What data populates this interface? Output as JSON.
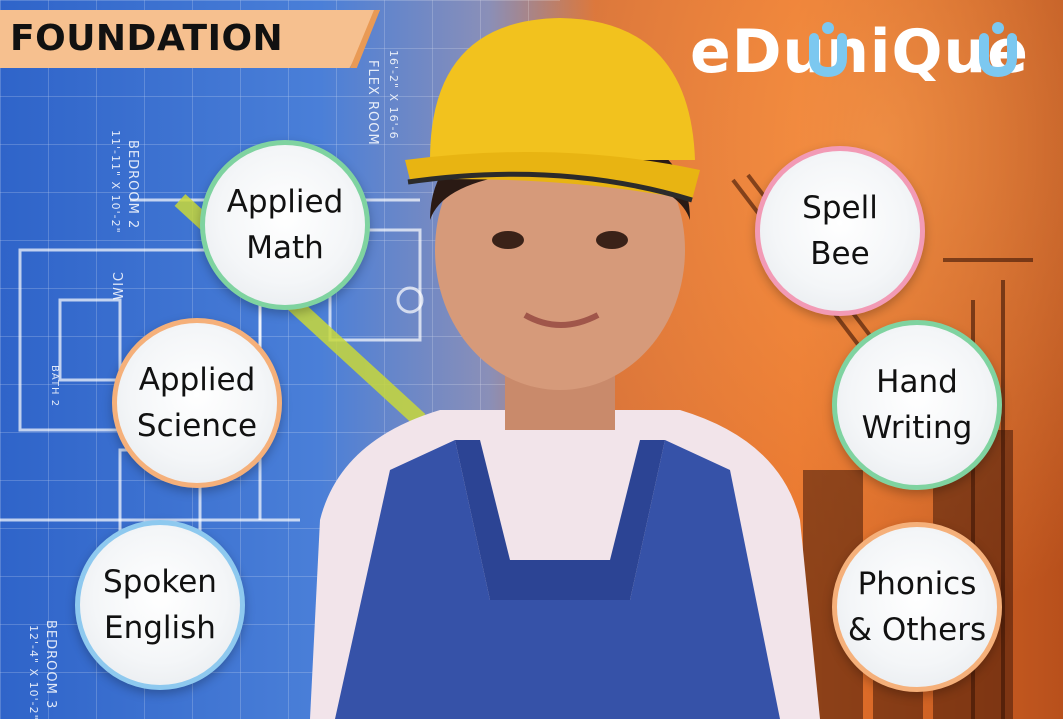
{
  "banner": {
    "label": "FOUNDATION"
  },
  "logo": {
    "text": "edunique",
    "primary_color": "#ffffff",
    "accent_color": "#7cc8f0"
  },
  "blueprint_texts": [
    "FLEX ROOM",
    "16'-2\" X 16'-6",
    "BEDROOM 2",
    "11'-11\" X 10'-2\"",
    "WIC",
    "BATH 2",
    "BEDROOM 3",
    "12'-4\" X 10'-2\""
  ],
  "courses": [
    {
      "id": "applied-math",
      "line1": "Applied",
      "line2": "Math",
      "ring_color": "#7fd3a0"
    },
    {
      "id": "applied-science",
      "line1": "Applied",
      "line2": "Science",
      "ring_color": "#f5b07a"
    },
    {
      "id": "spoken-english",
      "line1": "Spoken",
      "line2": "English",
      "ring_color": "#8ec9ef"
    },
    {
      "id": "spell-bee",
      "line1": "Spell",
      "line2": "Bee",
      "ring_color": "#f29ab5"
    },
    {
      "id": "hand-writing",
      "line1": "Hand",
      "line2": "Writing",
      "ring_color": "#7fd3a0"
    },
    {
      "id": "phonics-others",
      "line1": "Phonics",
      "line2": "& Others",
      "ring_color": "#f5b07a"
    }
  ]
}
